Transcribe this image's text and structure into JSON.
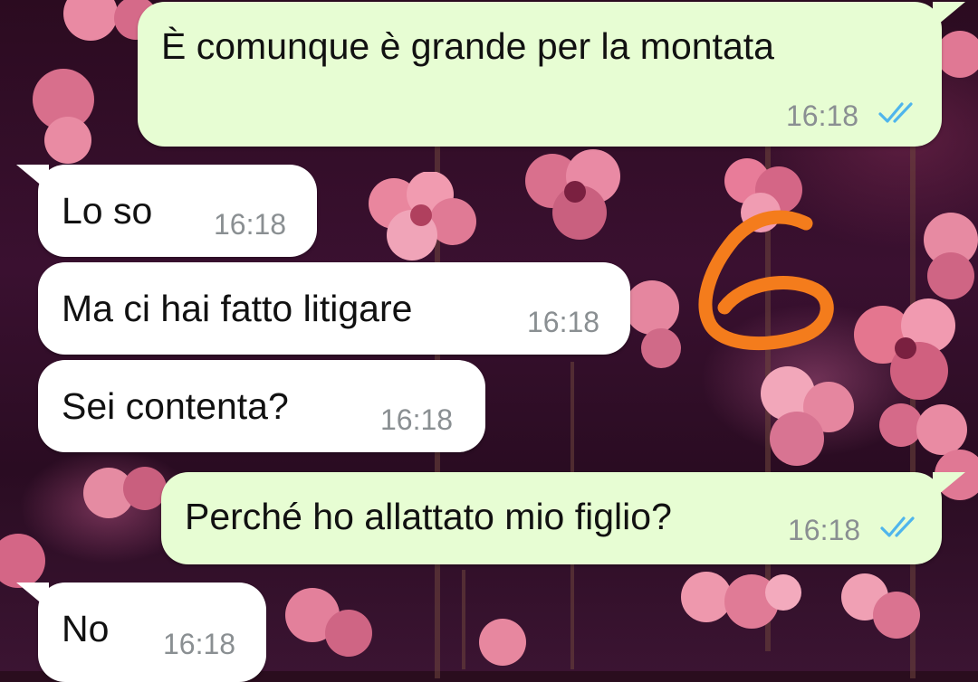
{
  "messages": [
    {
      "text": "È comunque è grande per la montata",
      "time": "16:18",
      "direction": "outgoing",
      "status": "read"
    },
    {
      "text": "Lo so",
      "time": "16:18",
      "direction": "incoming"
    },
    {
      "text": "Ma ci hai fatto litigare",
      "time": "16:18",
      "direction": "incoming"
    },
    {
      "text": "Sei contenta?",
      "time": "16:18",
      "direction": "incoming"
    },
    {
      "text": "Perché ho allattato mio figlio?",
      "time": "16:18",
      "direction": "outgoing",
      "status": "read"
    },
    {
      "text": "No",
      "time": "16:18",
      "direction": "incoming"
    }
  ],
  "annotation": {
    "label": "6",
    "color": "#f47c1c"
  },
  "colors": {
    "outgoing_bubble": "#e7fdd3",
    "incoming_bubble": "#ffffff",
    "read_ticks": "#4fb5ec",
    "timestamp": "#8a8f92"
  },
  "icons": {
    "read_receipt": "double-check-icon"
  }
}
